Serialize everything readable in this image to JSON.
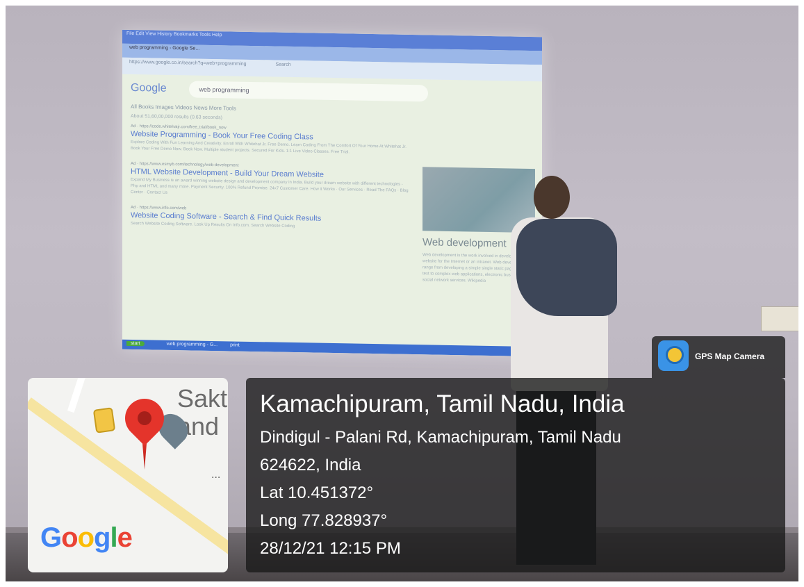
{
  "projected_screen": {
    "menu": "File  Edit  View  History  Bookmarks  Tools  Help",
    "tab_title": "web programming - Google Se...",
    "url": "https://www.google.co.in/search?q=web+programming",
    "search_placeholder": "Search",
    "google_logo": "Google",
    "query": "web programming",
    "tabs": "All   Books   Images   Videos   News   More          Tools",
    "stats": "About 51,60,00,000 results (0.63 seconds)",
    "ads": [
      {
        "url": "Ad · https://code.whitehatjr.com/free_trial/book_now",
        "title": "Website Programming - Book Your Free Coding Class",
        "text": "Explore Coding With Fun Learning And Creativity. Enroll With Whitehat Jr. Free Demo. Learn Coding From The Comfort Of Your Home At Whitehat Jr. Book Your Free Demo Now. Book Now. Multiple student projects. Secured For Kids. 1:1 Live Video Classes. Free Trial."
      },
      {
        "url": "Ad · https://www.esmyb.com/technology/web-development",
        "title": "HTML Website Development - Build Your Dream Website",
        "text": "Expand My Business is an award winning website design and development company in India. Build your dream website with different technologies - Php and HTML and many more. Payment Security. 100% Refund Promise. 24x7 Customer Care. How it Works · Our Services · Read The FAQs · Blog Center · Contact Us"
      },
      {
        "url": "Ad · https://www.info.com/web",
        "title": "Website Coding Software - Search & Find Quick Results",
        "text": "Search Website Coding Software. Look Up Results On Info.com. Search Website Coding"
      }
    ],
    "knowledge_title": "Web development",
    "knowledge_text": "Web development is the work involved in developing a website for the Internet or an intranet. Web development can range from developing a simple single static page of plain text to complex web applications, electronic businesses, and social network services. Wikipedia",
    "taskbar_start": "start",
    "taskbar_item": "web programming - G...",
    "taskbar_item2": "print"
  },
  "gps_badge": {
    "app_name": "GPS Map Camera"
  },
  "map": {
    "place_label_line1": "Sakt",
    "place_label_line2": "and",
    "more_dots": "···",
    "google_logo": "Google",
    "logo_colors": [
      "#4285F4",
      "#EA4335",
      "#FBBC05",
      "#4285F4",
      "#34A853",
      "#EA4335"
    ]
  },
  "location": {
    "title": "Kamachipuram, Tamil Nadu, India",
    "address_line1": "Dindigul - Palani Rd, Kamachipuram, Tamil Nadu",
    "address_line2": "624622, India",
    "lat": "Lat 10.451372°",
    "long": "Long 77.828937°",
    "datetime": "28/12/21 12:15 PM"
  }
}
